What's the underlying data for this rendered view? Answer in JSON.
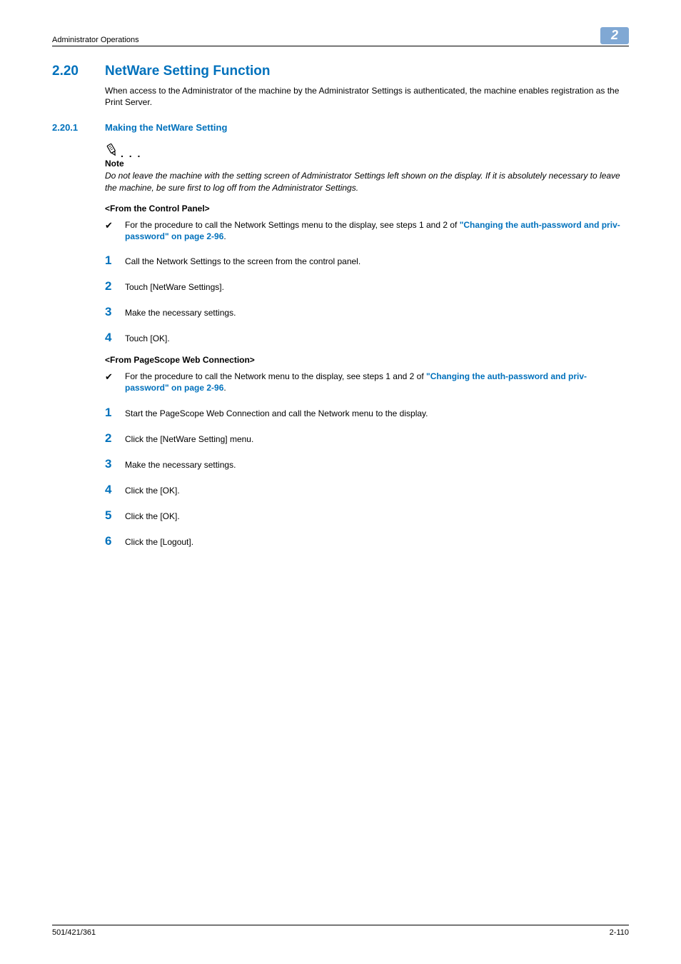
{
  "header": {
    "left": "Administrator Operations",
    "badge": "2"
  },
  "h1": {
    "num": "2.20",
    "title": "NetWare Setting Function"
  },
  "intro": "When access to the Administrator of the machine by the Administrator Settings is authenticated, the machine enables registration as the Print Server.",
  "h2": {
    "num": "2.20.1",
    "title": "Making the NetWare Setting"
  },
  "note": {
    "dots": ". . .",
    "label": "Note",
    "text": "Do not leave the machine with the setting screen of Administrator Settings left shown on the display. If it is absolutely necessary to leave the machine, be sure first to log off from the Administrator Settings."
  },
  "cp": {
    "heading": "<From the Control Panel>",
    "bullet_pre": "For the procedure to call the Network Settings menu to the display, see steps 1 and 2 of ",
    "bullet_link": "\"Changing the auth-password and priv-password\" on page 2-96",
    "bullet_post": ".",
    "steps": [
      "Call the Network Settings to the screen from the control panel.",
      "Touch [NetWare Settings].",
      "Make the necessary settings.",
      "Touch [OK]."
    ]
  },
  "wc": {
    "heading": "<From PageScope Web Connection>",
    "bullet_pre": "For the procedure to call the Network menu to the display, see steps 1 and 2 of ",
    "bullet_link": "\"Changing the auth-password and priv-password\" on page 2-96",
    "bullet_post": ".",
    "steps": [
      "Start the PageScope Web Connection and call the Network menu to the display.",
      "Click the [NetWare Setting] menu.",
      "Make the necessary settings.",
      "Click the [OK].",
      "Click the [OK].",
      "Click the [Logout]."
    ]
  },
  "footer": {
    "left": "501/421/361",
    "right": "2-110"
  }
}
